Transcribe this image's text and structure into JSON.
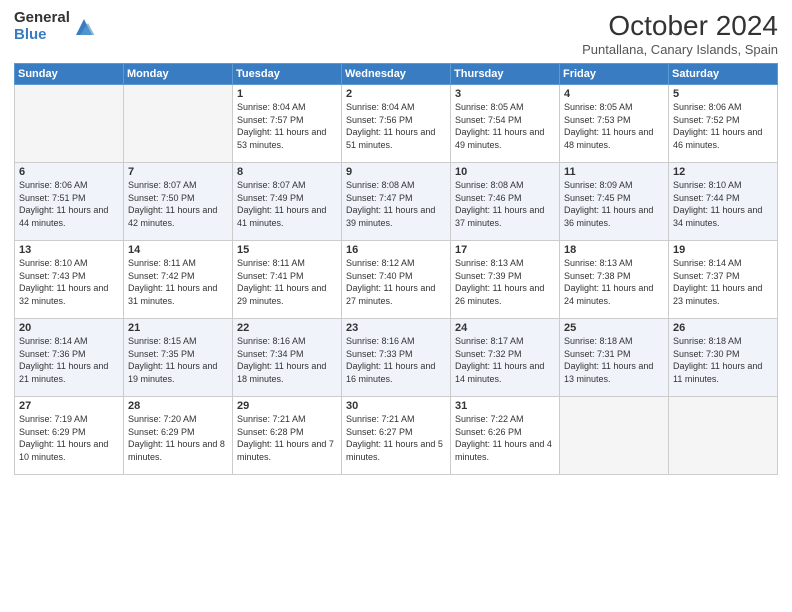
{
  "header": {
    "logo_general": "General",
    "logo_blue": "Blue",
    "month_title": "October 2024",
    "location": "Puntallana, Canary Islands, Spain"
  },
  "days_of_week": [
    "Sunday",
    "Monday",
    "Tuesday",
    "Wednesday",
    "Thursday",
    "Friday",
    "Saturday"
  ],
  "weeks": [
    [
      {
        "day": "",
        "info": ""
      },
      {
        "day": "",
        "info": ""
      },
      {
        "day": "1",
        "info": "Sunrise: 8:04 AM\nSunset: 7:57 PM\nDaylight: 11 hours and 53 minutes."
      },
      {
        "day": "2",
        "info": "Sunrise: 8:04 AM\nSunset: 7:56 PM\nDaylight: 11 hours and 51 minutes."
      },
      {
        "day": "3",
        "info": "Sunrise: 8:05 AM\nSunset: 7:54 PM\nDaylight: 11 hours and 49 minutes."
      },
      {
        "day": "4",
        "info": "Sunrise: 8:05 AM\nSunset: 7:53 PM\nDaylight: 11 hours and 48 minutes."
      },
      {
        "day": "5",
        "info": "Sunrise: 8:06 AM\nSunset: 7:52 PM\nDaylight: 11 hours and 46 minutes."
      }
    ],
    [
      {
        "day": "6",
        "info": "Sunrise: 8:06 AM\nSunset: 7:51 PM\nDaylight: 11 hours and 44 minutes."
      },
      {
        "day": "7",
        "info": "Sunrise: 8:07 AM\nSunset: 7:50 PM\nDaylight: 11 hours and 42 minutes."
      },
      {
        "day": "8",
        "info": "Sunrise: 8:07 AM\nSunset: 7:49 PM\nDaylight: 11 hours and 41 minutes."
      },
      {
        "day": "9",
        "info": "Sunrise: 8:08 AM\nSunset: 7:47 PM\nDaylight: 11 hours and 39 minutes."
      },
      {
        "day": "10",
        "info": "Sunrise: 8:08 AM\nSunset: 7:46 PM\nDaylight: 11 hours and 37 minutes."
      },
      {
        "day": "11",
        "info": "Sunrise: 8:09 AM\nSunset: 7:45 PM\nDaylight: 11 hours and 36 minutes."
      },
      {
        "day": "12",
        "info": "Sunrise: 8:10 AM\nSunset: 7:44 PM\nDaylight: 11 hours and 34 minutes."
      }
    ],
    [
      {
        "day": "13",
        "info": "Sunrise: 8:10 AM\nSunset: 7:43 PM\nDaylight: 11 hours and 32 minutes."
      },
      {
        "day": "14",
        "info": "Sunrise: 8:11 AM\nSunset: 7:42 PM\nDaylight: 11 hours and 31 minutes."
      },
      {
        "day": "15",
        "info": "Sunrise: 8:11 AM\nSunset: 7:41 PM\nDaylight: 11 hours and 29 minutes."
      },
      {
        "day": "16",
        "info": "Sunrise: 8:12 AM\nSunset: 7:40 PM\nDaylight: 11 hours and 27 minutes."
      },
      {
        "day": "17",
        "info": "Sunrise: 8:13 AM\nSunset: 7:39 PM\nDaylight: 11 hours and 26 minutes."
      },
      {
        "day": "18",
        "info": "Sunrise: 8:13 AM\nSunset: 7:38 PM\nDaylight: 11 hours and 24 minutes."
      },
      {
        "day": "19",
        "info": "Sunrise: 8:14 AM\nSunset: 7:37 PM\nDaylight: 11 hours and 23 minutes."
      }
    ],
    [
      {
        "day": "20",
        "info": "Sunrise: 8:14 AM\nSunset: 7:36 PM\nDaylight: 11 hours and 21 minutes."
      },
      {
        "day": "21",
        "info": "Sunrise: 8:15 AM\nSunset: 7:35 PM\nDaylight: 11 hours and 19 minutes."
      },
      {
        "day": "22",
        "info": "Sunrise: 8:16 AM\nSunset: 7:34 PM\nDaylight: 11 hours and 18 minutes."
      },
      {
        "day": "23",
        "info": "Sunrise: 8:16 AM\nSunset: 7:33 PM\nDaylight: 11 hours and 16 minutes."
      },
      {
        "day": "24",
        "info": "Sunrise: 8:17 AM\nSunset: 7:32 PM\nDaylight: 11 hours and 14 minutes."
      },
      {
        "day": "25",
        "info": "Sunrise: 8:18 AM\nSunset: 7:31 PM\nDaylight: 11 hours and 13 minutes."
      },
      {
        "day": "26",
        "info": "Sunrise: 8:18 AM\nSunset: 7:30 PM\nDaylight: 11 hours and 11 minutes."
      }
    ],
    [
      {
        "day": "27",
        "info": "Sunrise: 7:19 AM\nSunset: 6:29 PM\nDaylight: 11 hours and 10 minutes."
      },
      {
        "day": "28",
        "info": "Sunrise: 7:20 AM\nSunset: 6:29 PM\nDaylight: 11 hours and 8 minutes."
      },
      {
        "day": "29",
        "info": "Sunrise: 7:21 AM\nSunset: 6:28 PM\nDaylight: 11 hours and 7 minutes."
      },
      {
        "day": "30",
        "info": "Sunrise: 7:21 AM\nSunset: 6:27 PM\nDaylight: 11 hours and 5 minutes."
      },
      {
        "day": "31",
        "info": "Sunrise: 7:22 AM\nSunset: 6:26 PM\nDaylight: 11 hours and 4 minutes."
      },
      {
        "day": "",
        "info": ""
      },
      {
        "day": "",
        "info": ""
      }
    ]
  ]
}
